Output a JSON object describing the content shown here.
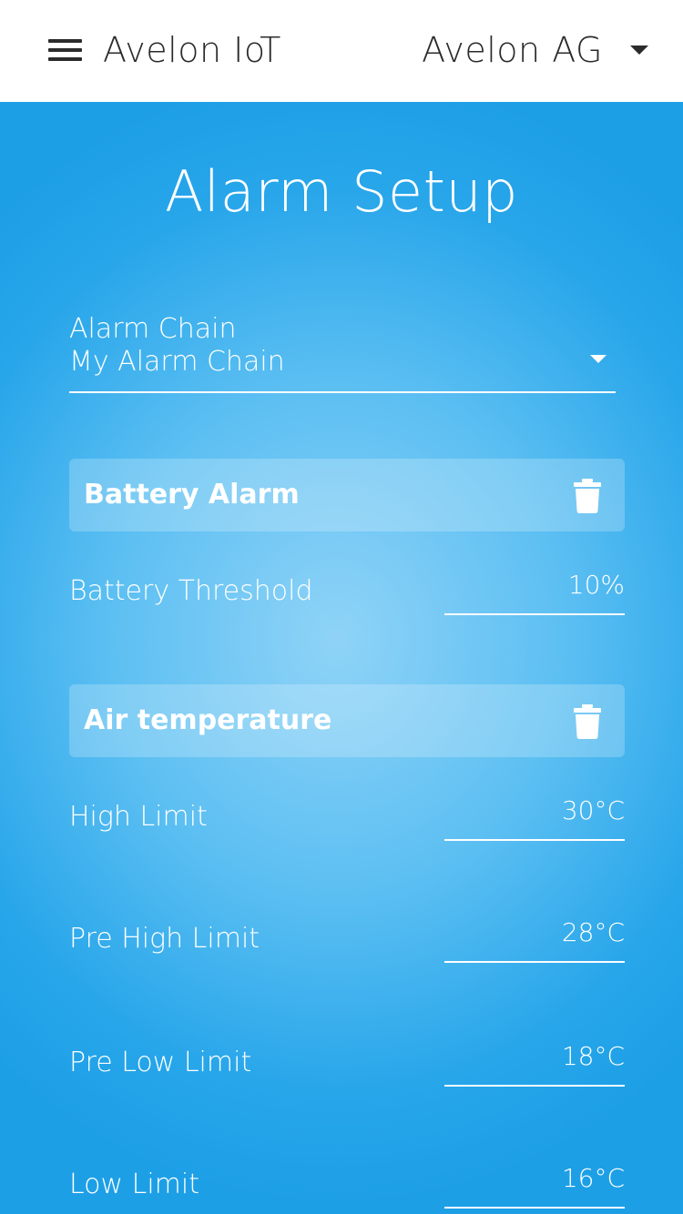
{
  "header": {
    "app_title": "Avelon IoT",
    "organization": "Avelon AG",
    "menu_icon": "hamburger-menu-icon",
    "org_caret_icon": "caret-down-icon"
  },
  "page": {
    "title": "Alarm Setup"
  },
  "alarm_chain": {
    "label": "Alarm Chain",
    "value": "My Alarm Chain",
    "caret_icon": "caret-down-icon"
  },
  "battery_alarm": {
    "title": "Battery Alarm",
    "delete_icon": "trash-icon",
    "rows": [
      {
        "label": "Battery Threshold",
        "value": "10%"
      }
    ]
  },
  "air_temperature": {
    "title": "Air temperature",
    "delete_icon": "trash-icon",
    "rows": [
      {
        "label": "High Limit",
        "value": "30°C"
      },
      {
        "label": "Pre High Limit",
        "value": "28°C"
      },
      {
        "label": "Pre Low Limit",
        "value": "18°C"
      },
      {
        "label": "Low Limit",
        "value": "16°C"
      }
    ]
  },
  "colors": {
    "header_bg": "#ffffff",
    "header_text": "#2b2b2b",
    "background_center": "#8fd3f7",
    "background_edge": "#1d9fe6",
    "text_on_blue": "#ffffff"
  }
}
